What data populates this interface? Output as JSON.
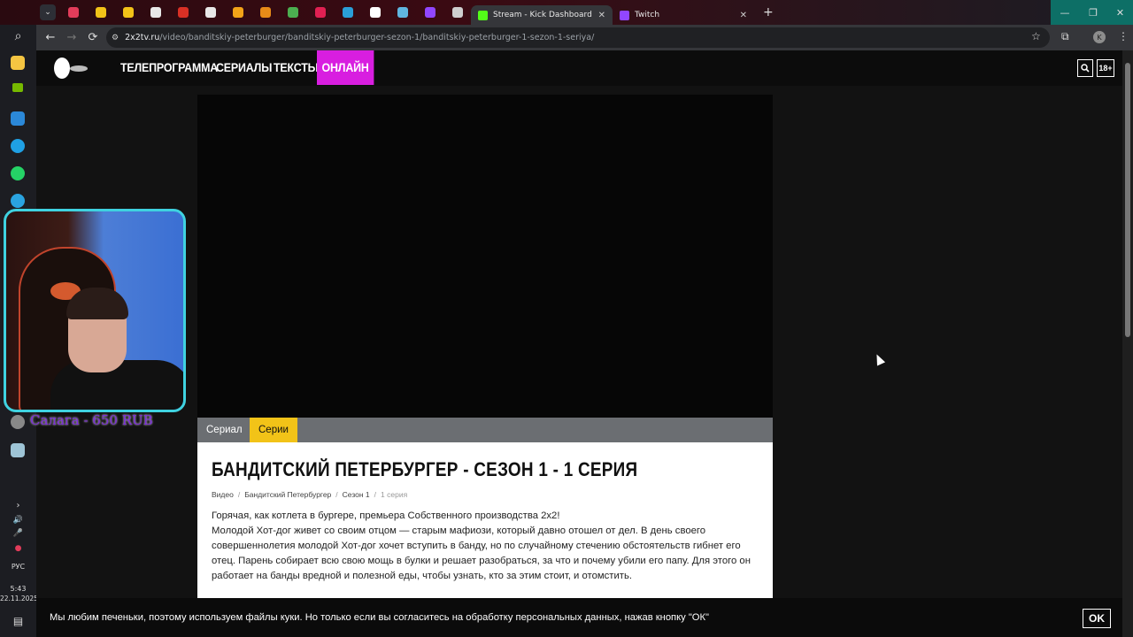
{
  "browser": {
    "tabs": [
      {
        "title": "Stream - Kick Dashboard",
        "favicon_color": "#53fc18",
        "active": true
      },
      {
        "title": "Twitch",
        "favicon_color": "#9146ff",
        "active": false
      }
    ],
    "pinned_tab_colors": [
      "#e23c5a",
      "#f2c318",
      "#f2c318",
      "#e8e8e8",
      "#d93025",
      "#e8e8e8",
      "#f2a318",
      "#e88b18",
      "#4caf50",
      "#e02052",
      "#2a9fd8",
      "#ffffff",
      "#60b6e0",
      "#9146ff",
      "#cfcfcf"
    ],
    "url": {
      "domain": "2x2tv.ru",
      "path": "/video/banditskiy-peterburger/banditskiy-peterburger-sezon-1/banditskiy-peterburger-1-sezon-1-seriya/"
    },
    "profile_initial": "K",
    "icons": {
      "back": "←",
      "forward": "→",
      "reload": "⟳",
      "star": "☆",
      "extensions": "⧉",
      "menu": "⋮",
      "new_tab": "+",
      "minimize": "—",
      "restore": "❐",
      "close": "✕",
      "tab_close": "✕",
      "tab_menu": "⌄"
    }
  },
  "taskbar": {
    "language": "РУС",
    "time": "5:43",
    "date": "22.11.2025"
  },
  "overlay": {
    "donation": "Салага - 650 RUB"
  },
  "site": {
    "nav": [
      "ТЕЛЕПРОГРАММА",
      "СЕРИАЛЫ",
      "ТЕКСТЫ",
      "ОНЛАЙН"
    ],
    "age_badge": "18+",
    "search_icon": "🔍",
    "tabs": {
      "series": "Сериал",
      "episodes": "Серии"
    },
    "title": "БАНДИТСКИЙ ПЕТЕРБУРГЕР - СЕЗОН 1 - 1 СЕРИЯ",
    "breadcrumbs": [
      "Видео",
      "Бандитский Петербургер",
      "Сезон 1",
      "1 серия"
    ],
    "description_lines": [
      "Горячая, как котлета в бургере, премьера Собственного производства 2х2!",
      "Молодой Хот-дог живет со своим отцом — старым мафиози, который давно отошел от дел. В день своего совершеннолетия молодой Хот-дог хочет вступить в банду, но по случайному стечению обстоятельств гибнет его отец. Парень собирает всю свою мощь в булки и решает разобраться, за что и почему убили его папу. Для этого он работает на банды вредной и полезной еды, чтобы узнать, кто за этим стоит, и отомстить."
    ],
    "cookie": {
      "text": "Мы любим печеньки, поэтому используем файлы куки. Но только если вы согласитесь на обработку персональных данных, нажав кнопку \"ОК\"",
      "button": "OK"
    }
  }
}
